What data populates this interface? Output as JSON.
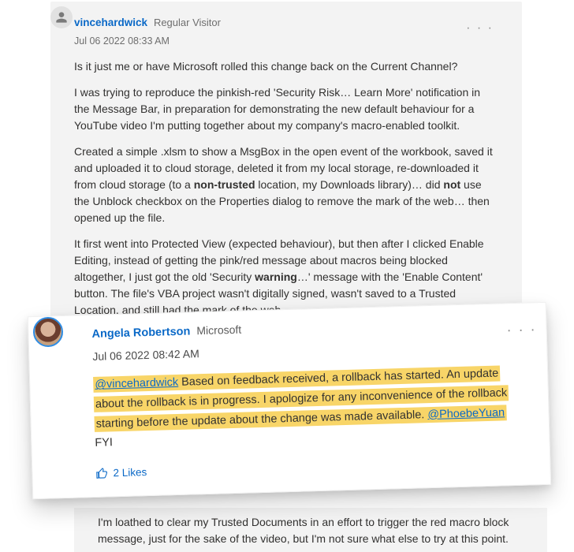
{
  "post1": {
    "author": "vincehardwick",
    "role": "Regular Visitor",
    "timestamp": "Jul 06 2022 08:33 AM",
    "more": "· · ·",
    "p1": "Is it just me or have Microsoft rolled this change back on the Current Channel?",
    "p2": "I was trying to reproduce the pinkish-red 'Security Risk… Learn More' notification in the Message Bar, in preparation for demonstrating the new default behaviour for a YouTube video I'm putting together about my company's macro-enabled toolkit.",
    "p3a": "Created a simple .xlsm to show a MsgBox in the open event of the workbook, saved it and uploaded it to cloud storage, deleted it from my local storage, re-downloaded it from cloud storage (to a ",
    "p3b_nontrusted": "non-trusted",
    "p3c": " location, my Downloads library)… did ",
    "p3d_not": "not",
    "p3e": " use the Unblock checkbox on the Properties dialog to remove the mark of the web… then opened up the file.",
    "p4a": "It first went into Protected View (expected behaviour), but then after I clicked Enable Editing, instead of getting the pink/red message about macros being blocked altogether, I just got the old 'Security ",
    "p4b_warning": "warning",
    "p4c": "…' message with the 'Enable Content' button. The file's VBA project wasn't digitally signed, wasn't saved to a Trusted Location, and still had the mark of the web"
  },
  "post2": {
    "author": "Angela Robertson",
    "role": "Microsoft",
    "timestamp": "Jul 06 2022 08:42 AM",
    "more": "· · ·",
    "mention1": "@vincehardwick",
    "body_mid": " Based on feedback received, a rollback has started. An update about the rollback is in progress. I apologize for any inconvenience of the rollback starting before the update about the change was made available. ",
    "mention2": "@PhoebeYuan",
    "fyi": " FYI",
    "likes": "2 Likes"
  },
  "trail": {
    "p1": "I'm loathed to clear my Trusted Documents in an effort to trigger the red macro block message, just for the sake of the video, but I'm not sure what else to try at this point."
  }
}
